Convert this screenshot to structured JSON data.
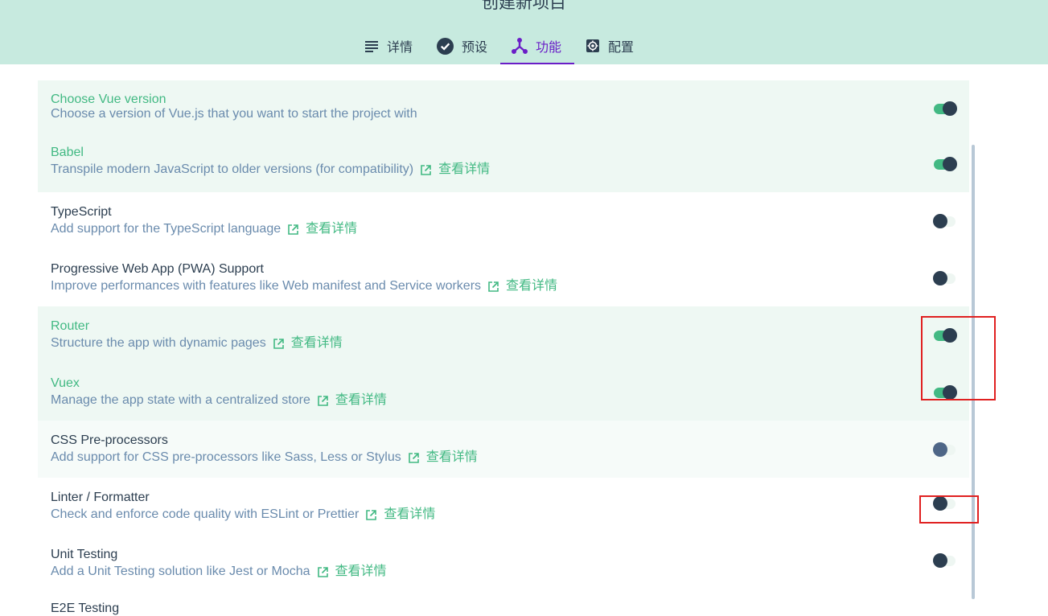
{
  "header": {
    "title": "创建新项目",
    "tabs": [
      {
        "label": "详情",
        "icon": "list-icon",
        "active": false
      },
      {
        "label": "预设",
        "icon": "check-circle-icon",
        "active": false
      },
      {
        "label": "功能",
        "icon": "tree-icon",
        "active": true
      },
      {
        "label": "配置",
        "icon": "gear-icon",
        "active": false
      }
    ]
  },
  "features": [
    {
      "name": "Choose Vue version",
      "desc": "Choose a version of Vue.js that you want to start the project with",
      "link": "",
      "enabled": true,
      "selected": true
    },
    {
      "name": "Babel",
      "desc": "Transpile modern JavaScript to older versions (for compatibility)",
      "link": "查看详情",
      "enabled": true,
      "selected": true
    },
    {
      "name": "TypeScript",
      "desc": "Add support for the TypeScript language",
      "link": "查看详情",
      "enabled": false,
      "selected": false
    },
    {
      "name": "Progressive Web App (PWA) Support",
      "desc": "Improve performances with features like Web manifest and Service workers",
      "link": "查看详情",
      "enabled": false,
      "selected": false
    },
    {
      "name": "Router",
      "desc": "Structure the app with dynamic pages",
      "link": "查看详情",
      "enabled": true,
      "selected": true
    },
    {
      "name": "Vuex",
      "desc": "Manage the app state with a centralized store",
      "link": "查看详情",
      "enabled": true,
      "selected": true
    },
    {
      "name": "CSS Pre-processors",
      "desc": "Add support for CSS pre-processors like Sass, Less or Stylus",
      "link": "查看详情",
      "enabled": false,
      "selected": false
    },
    {
      "name": "Linter / Formatter",
      "desc": "Check and enforce code quality with ESLint or Prettier",
      "link": "查看详情",
      "enabled": false,
      "selected": false
    },
    {
      "name": "Unit Testing",
      "desc": "Add a Unit Testing solution like Jest or Mocha",
      "link": "查看详情",
      "enabled": false,
      "selected": false
    }
  ],
  "partial_next_row": "E2E Testing",
  "colors": {
    "accent": "#42b983",
    "active_tab": "#6a1ec7",
    "header_bg": "#c7eadf",
    "annotation": "#e02020"
  }
}
